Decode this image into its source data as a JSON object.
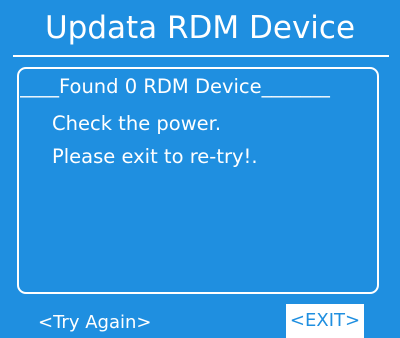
{
  "screen": {
    "title": "Updata RDM Device"
  },
  "panel": {
    "heading": "____Found 0 RDM Device_______",
    "lines": [
      "Check the power.",
      "Please exit to re-try!."
    ]
  },
  "footer": {
    "try_again_label": "<Try Again>",
    "exit_label": "<EXIT>",
    "selected": "exit"
  },
  "colors": {
    "background": "#1f8fe0",
    "foreground": "#ffffff",
    "selected_bg": "#ffffff",
    "selected_fg": "#1f8fe0"
  }
}
